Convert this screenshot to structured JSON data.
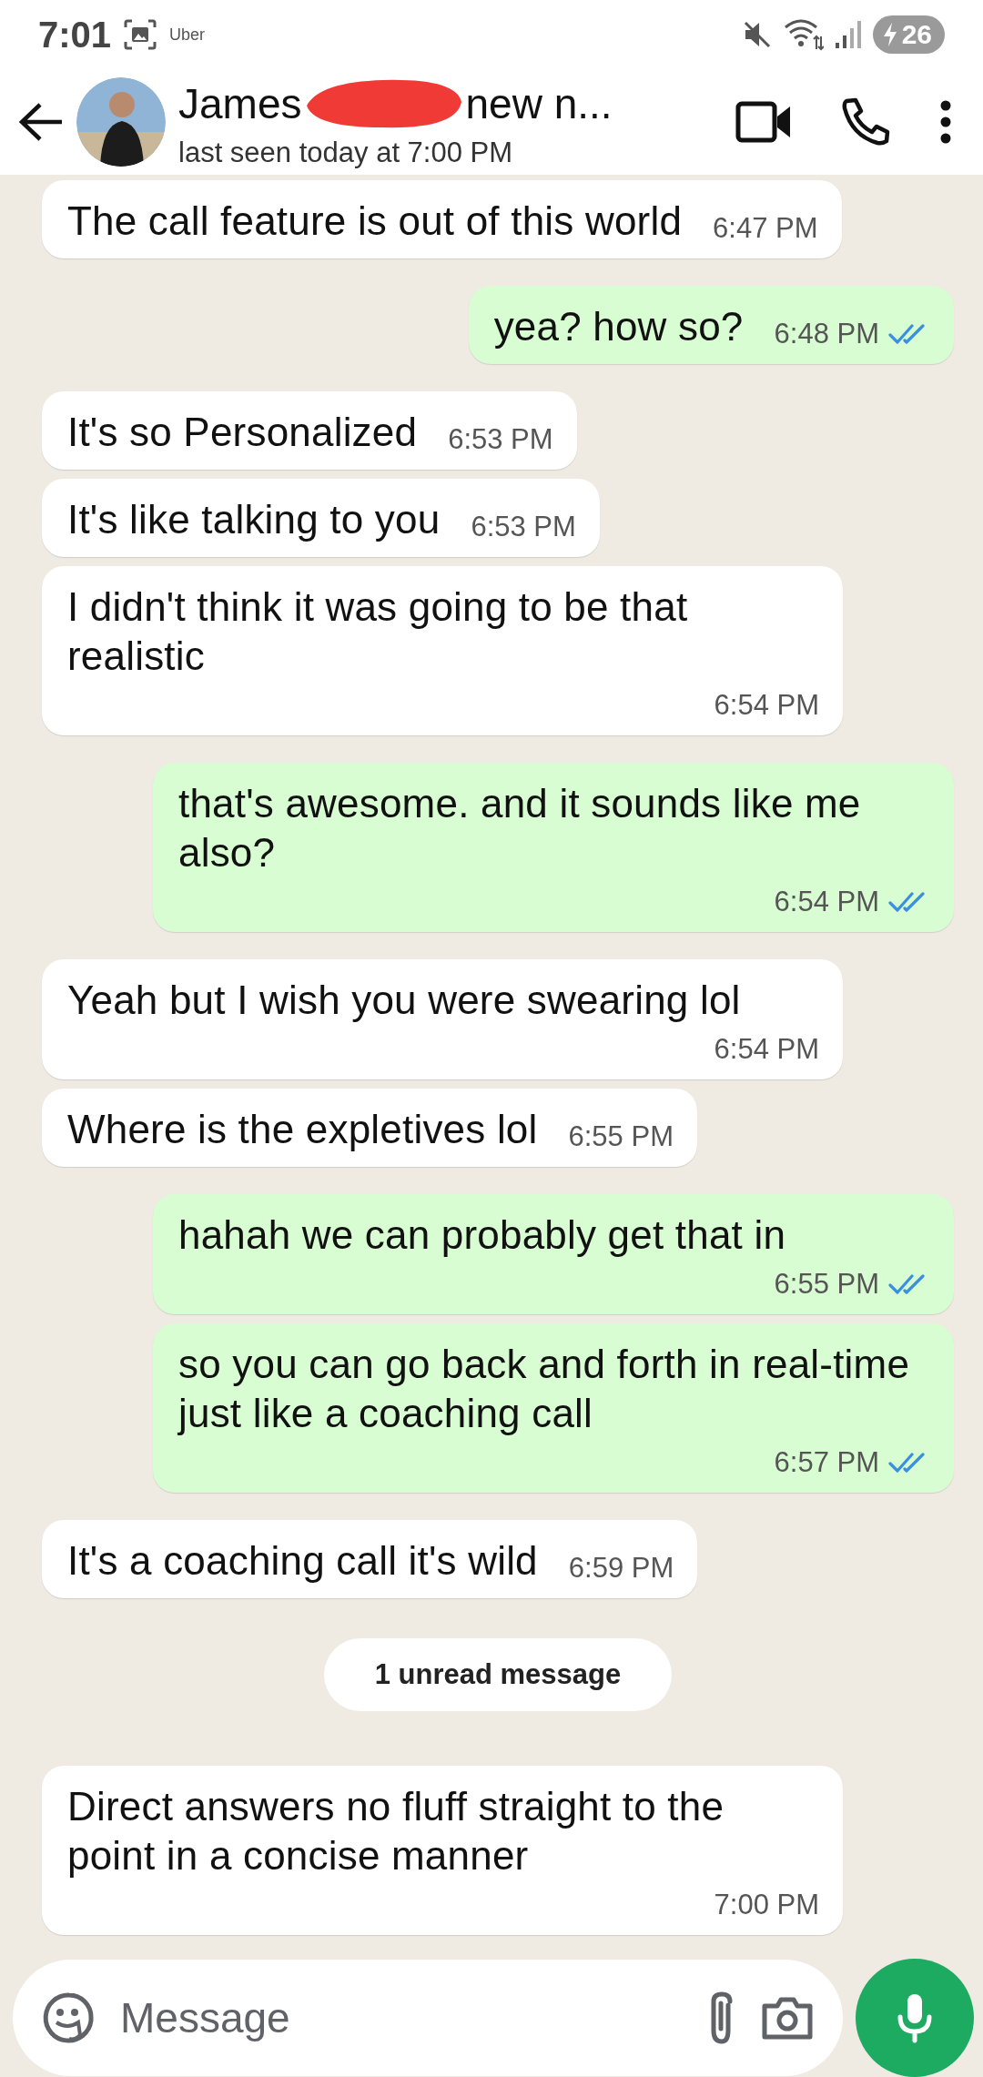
{
  "status_bar": {
    "time": "7:01",
    "app_label": "Uber",
    "battery": "26"
  },
  "header": {
    "name_start": "James",
    "name_end": "new n...",
    "status": "last seen today at 7:00 PM"
  },
  "messages": [
    {
      "kind": "incoming",
      "text": "The call feature is out of this world",
      "time": "6:47 PM"
    },
    {
      "kind": "outgoing",
      "text": "yea? how so?",
      "time": "6:48 PM",
      "read": true
    },
    {
      "kind": "incoming",
      "text": "It's so Personalized",
      "time": "6:53 PM"
    },
    {
      "kind": "incoming",
      "text": "It's like talking to you",
      "time": "6:53 PM"
    },
    {
      "kind": "incoming",
      "text": "I didn't think it was going to be that realistic",
      "time": "6:54 PM"
    },
    {
      "kind": "outgoing",
      "text": "that's awesome. and it sounds like me also?",
      "time": "6:54 PM",
      "read": true
    },
    {
      "kind": "incoming",
      "text": "Yeah but I wish you were swearing lol",
      "time": "6:54 PM"
    },
    {
      "kind": "incoming",
      "text": "Where is the expletives lol",
      "time": "6:55 PM"
    },
    {
      "kind": "outgoing",
      "text": "hahah we can probably get that in",
      "time": "6:55 PM",
      "read": true
    },
    {
      "kind": "outgoing",
      "text": "so you can go back and forth in real-time just like a coaching call",
      "time": "6:57 PM",
      "read": true
    },
    {
      "kind": "incoming",
      "text": "It's a coaching call it's wild",
      "time": "6:59 PM"
    },
    {
      "kind": "divider",
      "text": "1 unread message"
    },
    {
      "kind": "incoming",
      "text": "Direct answers no fluff straight to the point in a concise manner",
      "time": "7:00 PM"
    }
  ],
  "composer": {
    "placeholder": "Message"
  }
}
